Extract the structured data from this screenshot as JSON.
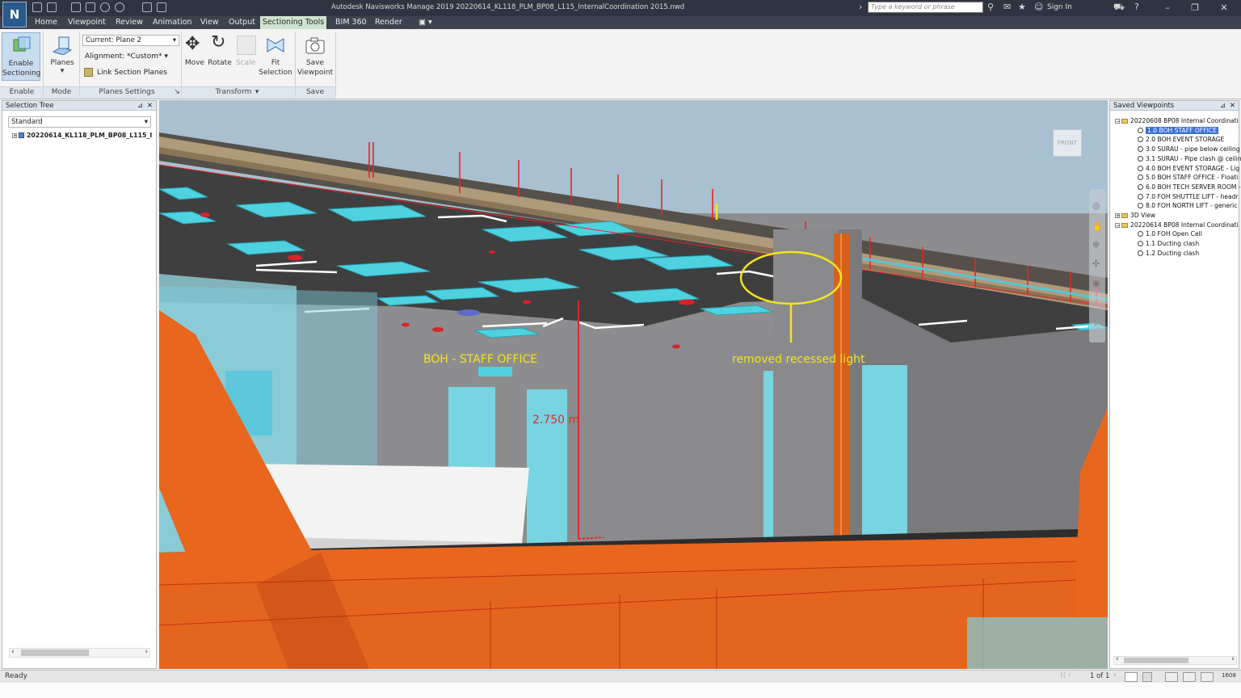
{
  "app": {
    "logo": "N",
    "title": "Autodesk Navisworks Manage 2019   20220614_KL118_PLM_BP08_L115_InternalCoordination 2015.nwd",
    "search_placeholder": "Type a keyword or phrase",
    "sign_in": "Sign In"
  },
  "menu": {
    "tabs": [
      "Home",
      "Viewpoint",
      "Review",
      "Animation",
      "View",
      "Output",
      "Sectioning Tools",
      "BIM 360",
      "Render"
    ],
    "active": "Sectioning Tools"
  },
  "ribbon": {
    "enable_btn": "Enable Sectioning",
    "planes_btn": "Planes",
    "current_plane": "Current: Plane 2",
    "alignment": "Alignment: *Custom*",
    "link_planes": "Link Section Planes",
    "move": "Move",
    "rotate": "Rotate",
    "scale": "Scale",
    "fit_selection": "Fit Selection",
    "save_viewpoint": "Save Viewpoint",
    "groups": {
      "enable": "Enable",
      "mode": "Mode",
      "planes_settings": "Planes Settings",
      "transform": "Transform",
      "save": "Save"
    }
  },
  "selection_tree": {
    "title": "Selection Tree",
    "dropdown": "Standard",
    "root": "20220614_KL118_PLM_BP08_L115_I"
  },
  "saved_viewpoints": {
    "title": "Saved Viewpoints",
    "items": [
      {
        "text": "20220608 BP08 Internal Coordinati",
        "kind": "folder",
        "level": 0,
        "exp": "−"
      },
      {
        "text": "1.0 BOH STAFF OFFICE",
        "kind": "view",
        "level": 1,
        "selected": true
      },
      {
        "text": "2.0 BOH EVENT STORAGE",
        "kind": "view",
        "level": 1
      },
      {
        "text": "3.0 SURAU - pipe below ceiling",
        "kind": "view",
        "level": 1
      },
      {
        "text": "3.1 SURAU - Pipe clash @ ceilin",
        "kind": "view",
        "level": 1
      },
      {
        "text": "4.0 BOH EVENT STORAGE - Lig",
        "kind": "view",
        "level": 1
      },
      {
        "text": "5.0 BOH STAFF OFFICE - Floati",
        "kind": "view",
        "level": 1
      },
      {
        "text": "6.0 BOH TECH SERVER ROOM -",
        "kind": "view",
        "level": 1
      },
      {
        "text": "7.0 FOH SHUTTLE LIFT - headr",
        "kind": "view",
        "level": 1
      },
      {
        "text": "8.0 FOH NORTH LIFT - generic",
        "kind": "view",
        "level": 1
      },
      {
        "text": "3D View",
        "kind": "folder",
        "level": 0,
        "exp": "+"
      },
      {
        "text": "20220614 BP08 Internal Coordinati",
        "kind": "folder",
        "level": 0,
        "exp": "−"
      },
      {
        "text": "1.0 FOH Open Cell",
        "kind": "view",
        "level": 1
      },
      {
        "text": "1.1 Ducting clash",
        "kind": "view",
        "level": 1
      },
      {
        "text": "1.2 Ducting clash",
        "kind": "view",
        "level": 1
      }
    ]
  },
  "viewport": {
    "room_label": "BOH - STAFF OFFICE",
    "dimension": "2.750 m",
    "annotation": "removed recessed light",
    "viewcube": "FRONT"
  },
  "status": {
    "text": "Ready",
    "page": "1 of 1",
    "memory": "1608"
  },
  "colors": {
    "accent_tab": "#cfe3cf",
    "steel": "#e8661e",
    "duct": "#4fd2df",
    "annotation": "#f5e41c",
    "dimension": "#e3262e"
  }
}
